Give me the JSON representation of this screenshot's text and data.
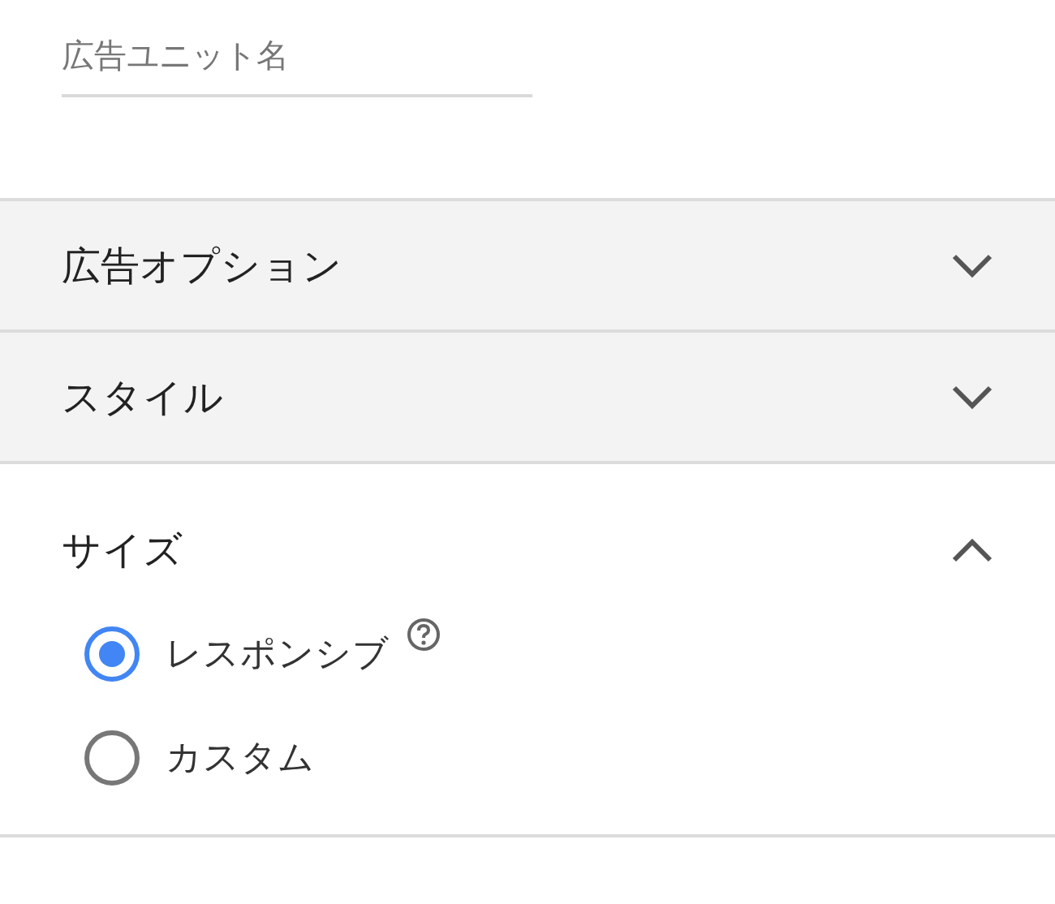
{
  "name_field": {
    "placeholder": "広告ユニット名"
  },
  "sections": [
    {
      "title": "広告オプション",
      "expanded": false
    },
    {
      "title": "スタイル",
      "expanded": false
    },
    {
      "title": "サイズ",
      "expanded": true,
      "options": [
        {
          "label": "レスポンシブ",
          "selected": true,
          "help": true
        },
        {
          "label": "カスタム",
          "selected": false,
          "help": false
        }
      ]
    }
  ]
}
